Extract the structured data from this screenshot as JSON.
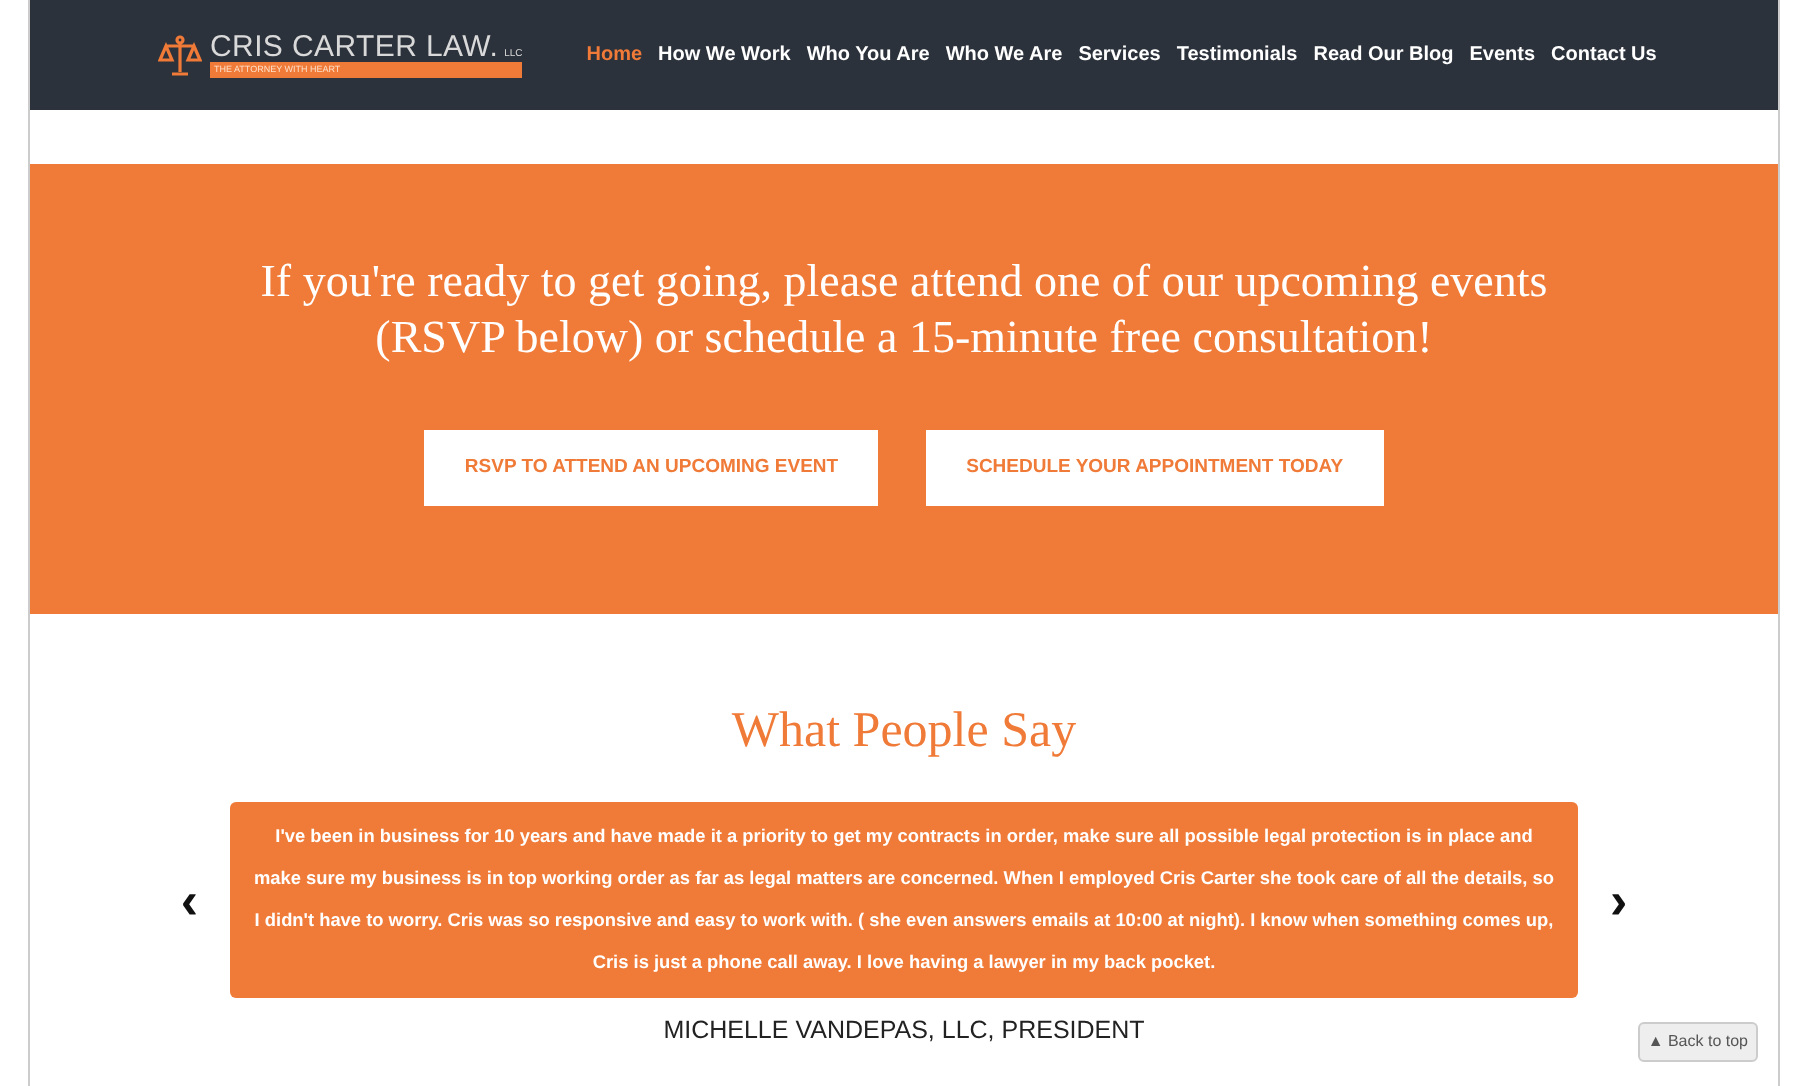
{
  "logo": {
    "name": "CRIS CARTER LAW.",
    "suffix": "LLC",
    "tagline": "THE ATTORNEY WITH HEART"
  },
  "nav": [
    {
      "label": "Home",
      "selected": true
    },
    {
      "label": "How We Work",
      "selected": false
    },
    {
      "label": "Who You Are",
      "selected": false
    },
    {
      "label": "Who We Are",
      "selected": false
    },
    {
      "label": "Services",
      "selected": false
    },
    {
      "label": "Testimonials",
      "selected": false
    },
    {
      "label": "Read Our Blog",
      "selected": false
    },
    {
      "label": "Events",
      "selected": false
    },
    {
      "label": "Contact Us",
      "selected": false
    }
  ],
  "cta": {
    "heading": "If you're ready to get going, please attend one of our upcoming events (RSVP below) or schedule a 15-minute free consultation!",
    "buttons": [
      "RSVP TO ATTEND AN UPCOMING EVENT",
      "SCHEDULE YOUR APPOINTMENT TODAY"
    ]
  },
  "testimonials": {
    "title": "What People Say",
    "quote": "I've been in business for 10 years and have made it a priority to get my contracts in order, make sure all possible legal protection is in place and make sure my business is in top working order as far as legal matters are concerned. When I employed Cris Carter she took care of all the details, so I didn't have to worry. Cris was so responsive and easy to work with. ( she even answers emails at 10:00 at night). I know when something comes up, Cris is just a phone call away. I love having a lawyer in my back pocket.",
    "author": "MICHELLE VANDEPAS, LLC, PRESIDENT",
    "prev": "‹",
    "next": "›"
  },
  "back_to_top": "▲ Back to top"
}
